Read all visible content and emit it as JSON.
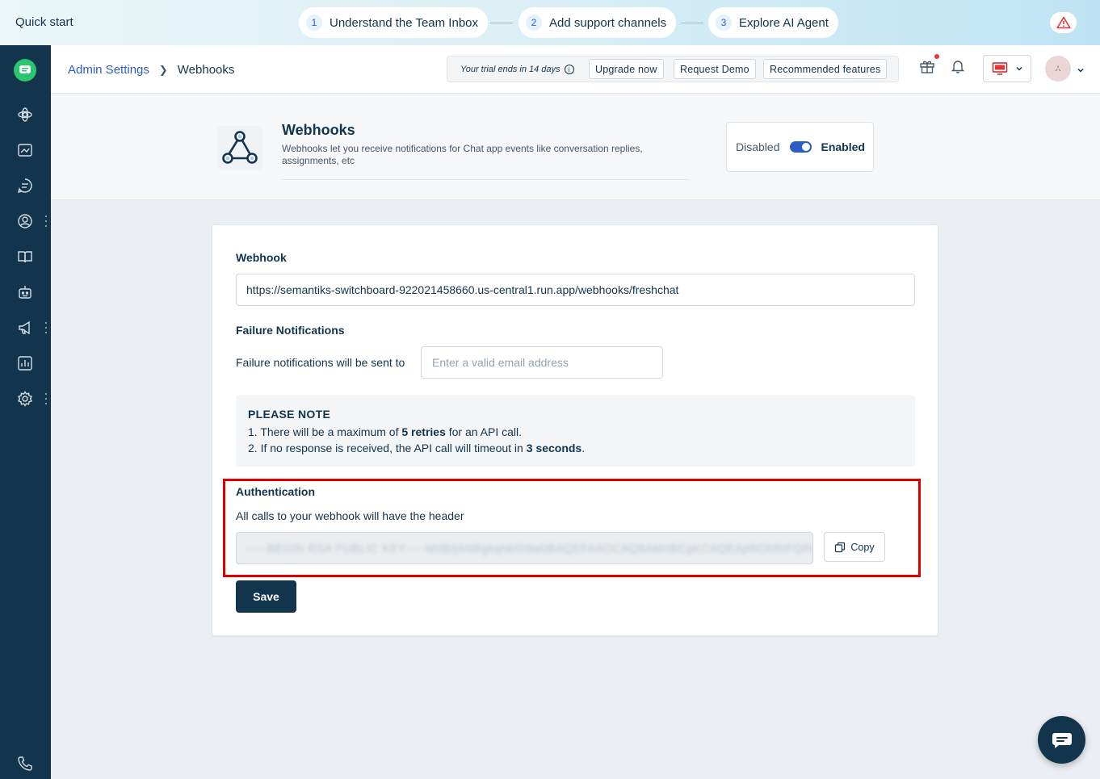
{
  "quick_start": {
    "title": "Quick start",
    "steps": [
      {
        "num": "1",
        "label": "Understand the Team Inbox"
      },
      {
        "num": "2",
        "label": "Add support channels"
      },
      {
        "num": "3",
        "label": "Explore AI Agent"
      }
    ],
    "alert_icon": "warning-triangle-icon"
  },
  "header": {
    "breadcrumb": {
      "parent": "Admin Settings",
      "current": "Webhooks"
    },
    "trial_text": "Your trial ends in 14 days",
    "buttons": {
      "upgrade": "Upgrade now",
      "demo": "Request Demo",
      "recommended": "Recommended features"
    }
  },
  "page": {
    "title": "Webhooks",
    "description": "Webhooks let you receive notifications for Chat app events like conversation replies, assignments, etc",
    "toggle": {
      "off_label": "Disabled",
      "on_label": "Enabled",
      "state": "enabled"
    }
  },
  "form": {
    "webhook_label": "Webhook",
    "webhook_url": "https://semantiks-switchboard-922021458660.us-central1.run.app/webhooks/freshchat",
    "failure_label": "Failure Notifications",
    "failure_text": "Failure notifications will be sent to",
    "email_placeholder": "Enter a valid email address",
    "note": {
      "title": "PLEASE NOTE",
      "line1_pre": "1. There will be a maximum of ",
      "line1_bold": "5 retries",
      "line1_post": " for an API call.",
      "line2_pre": "2. If no response is received, the API call will timeout in ",
      "line2_bold": "3 seconds",
      "line2_post": "."
    },
    "auth_label": "Authentication",
    "auth_desc": "All calls to your webhook will have the header",
    "auth_key_blurred": "-----BEGIN RSA PUBLIC KEY-----MIIBIjANBgkqhkiG9w0BAQEFAAOCAQ8AMIIBCgKCAQEApROhRIFQRvyl",
    "copy_label": "Copy",
    "save_label": "Save"
  },
  "colors": {
    "navy": "#12344d",
    "link_blue": "#2c5cc5",
    "highlight_red": "#e00000",
    "green_logo": "#28c76f"
  }
}
